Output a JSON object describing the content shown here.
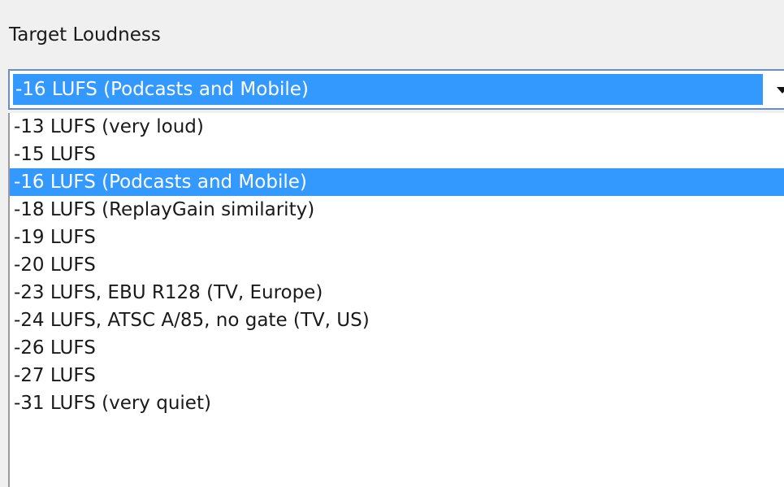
{
  "field": {
    "label": "Target Loudness",
    "selected_value": "-16 LUFS (Podcasts and Mobile)",
    "arrow_icon": "dropdown-arrow-icon"
  },
  "dropdown": {
    "options": [
      "-13 LUFS (very loud)",
      "-15 LUFS",
      "-16 LUFS (Podcasts and Mobile)",
      "-18 LUFS (ReplayGain similarity)",
      "-19 LUFS",
      "-20 LUFS",
      "-23 LUFS, EBU R128 (TV, Europe)",
      "-24 LUFS, ATSC A/85, no gate (TV, US)",
      "-26 LUFS",
      "-27 LUFS",
      "-31 LUFS (very quiet)"
    ],
    "highlighted": "-16 LUFS (Podcasts and Mobile)"
  },
  "colors": {
    "selection": "#3399ff",
    "combo_border": "#6a8fc0",
    "background": "#f0f0f0"
  }
}
